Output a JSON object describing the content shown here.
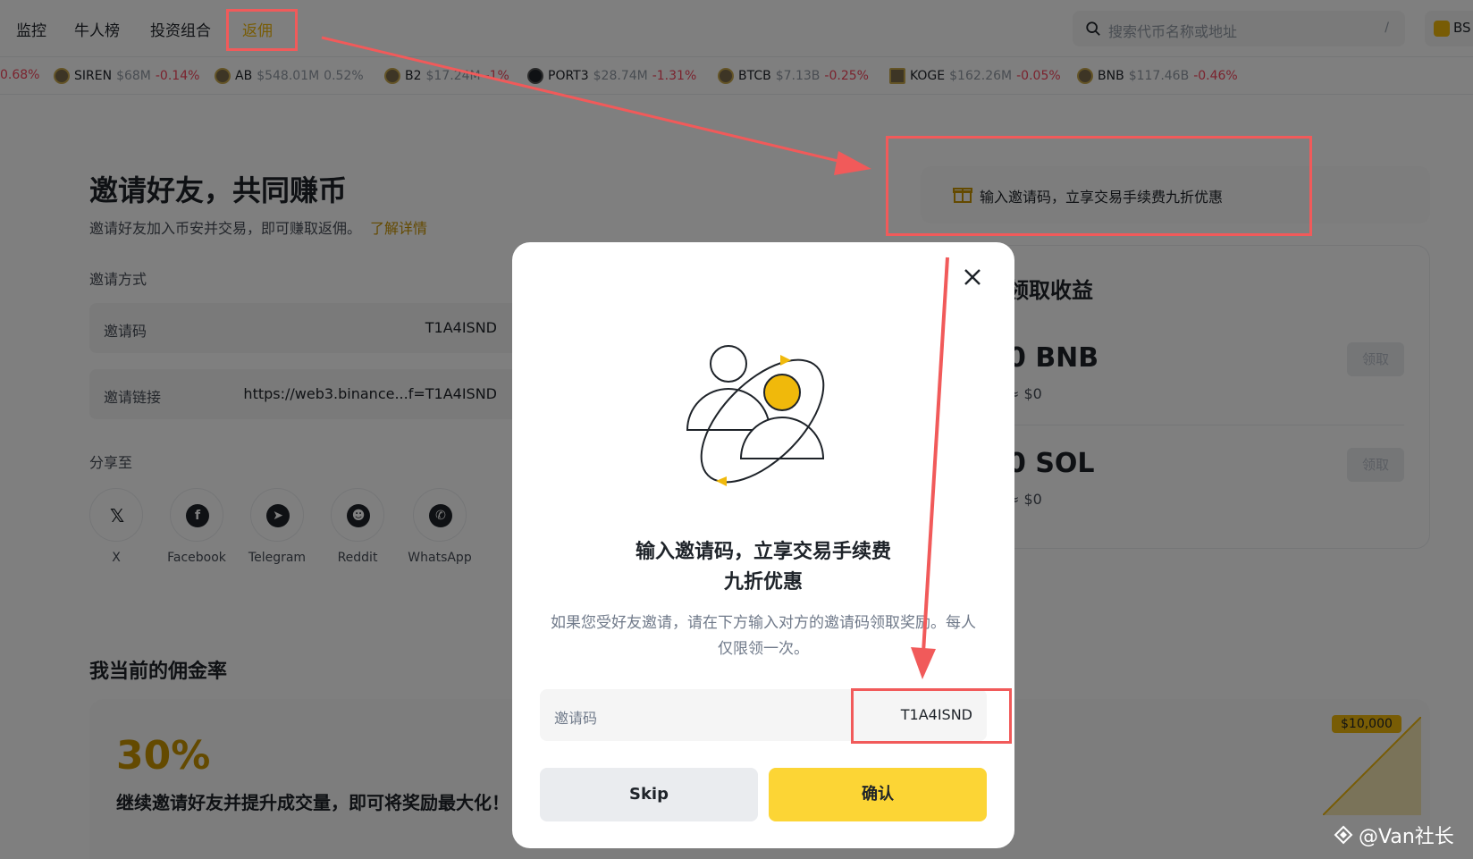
{
  "nav": {
    "items": [
      {
        "label": "监控"
      },
      {
        "label": "牛人榜"
      },
      {
        "label": "投资组合"
      },
      {
        "label": "返佣"
      }
    ],
    "search_placeholder": "搜索代币名称或地址",
    "search_shortcut": "/",
    "chain_label": "BS"
  },
  "ticker": [
    {
      "symbol": "",
      "cap": "",
      "change": "0.68%"
    },
    {
      "symbol": "SIREN",
      "cap": "$68M",
      "change": "-0.14%"
    },
    {
      "symbol": "AB",
      "cap": "$548.01M",
      "change": "0.52%"
    },
    {
      "symbol": "B2",
      "cap": "$17.24M",
      "change": "-1%"
    },
    {
      "symbol": "PORT3",
      "cap": "$28.74M",
      "change": "-1.31%"
    },
    {
      "symbol": "BTCB",
      "cap": "$7.13B",
      "change": "-0.25%"
    },
    {
      "symbol": "KOGE",
      "cap": "$162.26M",
      "change": "-0.05%"
    },
    {
      "symbol": "BNB",
      "cap": "$117.46B",
      "change": "-0.46%"
    }
  ],
  "page": {
    "title": "邀请好友，共同赚币",
    "subtitle": "邀请好友加入币安并交易，即可赚取返佣。",
    "learn_more": "了解详情",
    "invite_method_label": "邀请方式",
    "invite_code_key": "邀请码",
    "invite_code_value": "T1A4ISND",
    "invite_link_key": "邀请链接",
    "invite_link_value": "https://web3.binance...f=T1A4ISND",
    "share_to_label": "分享至",
    "share": [
      {
        "label": "X",
        "icon": "x-icon",
        "glyph": "𝕏"
      },
      {
        "label": "Facebook",
        "icon": "facebook-icon",
        "glyph": "f"
      },
      {
        "label": "Telegram",
        "icon": "telegram-icon",
        "glyph": "➤"
      },
      {
        "label": "Reddit",
        "icon": "reddit-icon",
        "glyph": "☻"
      },
      {
        "label": "WhatsApp",
        "icon": "whatsapp-icon",
        "glyph": "✆"
      }
    ]
  },
  "promo": {
    "text": "输入邀请码，立享交易手续费九折优惠",
    "icon": "gift-icon"
  },
  "rewards": {
    "title": "领取收益",
    "items": [
      {
        "amount": "0 BNB",
        "usd": "≈ $0",
        "claim": "领取"
      },
      {
        "amount": "0 SOL",
        "usd": "≈ $0",
        "claim": "领取"
      }
    ]
  },
  "commission": {
    "title": "我当前的佣金率",
    "rate": "30%",
    "desc": "继续邀请好友并提升成交量，即可将奖励最大化！",
    "milestone": "$10,000"
  },
  "modal": {
    "title_line1": "输入邀请码，立享交易手续费",
    "title_line2": "九折优惠",
    "desc": "如果您受好友邀请，请在下方输入对方的邀请码领取奖励。每人仅限领一次。",
    "input_placeholder": "邀请码",
    "input_value": "T1A4ISND",
    "skip_label": "Skip",
    "confirm_label": "确认"
  },
  "watermark": "@Van社长",
  "colors": {
    "accent": "#F0B90B",
    "confirm": "#FCD535",
    "negative": "#F6465D",
    "annotation": "#F15A5A"
  }
}
